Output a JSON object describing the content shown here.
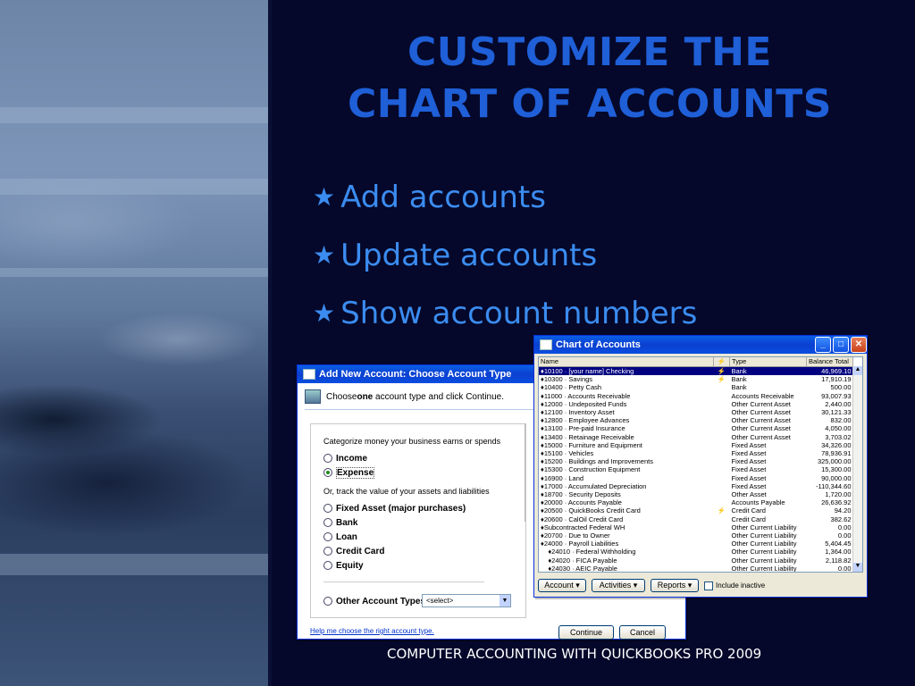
{
  "slide": {
    "title_line1": "CUSTOMIZE THE",
    "title_line2": "CHART OF ACCOUNTS",
    "bullets": [
      "Add accounts",
      "Update accounts",
      "Show account numbers"
    ],
    "bullet_icon": "star-icon",
    "footer": "COMPUTER ACCOUNTING WITH QUICKBOOKS PRO 2009",
    "colors": {
      "background": "#05082a",
      "title": "#1f5fd8",
      "bullet": "#3b8cf0",
      "footer": "#ffffff"
    }
  },
  "add_account_dialog": {
    "title": "Add New Account: Choose Account Type",
    "instruction_pre": "Choose ",
    "instruction_bold": "one",
    "instruction_post": " account type and click Continue.",
    "group1_label": "Categorize money your business earns or spends",
    "group1_options": [
      "Income",
      "Expense"
    ],
    "group2_label": "Or, track the value of your assets and liabilities",
    "group2_options": [
      "Fixed Asset (major purchases)",
      "Bank",
      "Loan",
      "Credit Card",
      "Equity"
    ],
    "other_label": "Other Account Types",
    "other_select": "<select>",
    "help_link": "Help me choose the right account type.",
    "continue_label": "Continue",
    "cancel_label": "Cancel"
  },
  "chart_of_accounts": {
    "title": "Chart of Accounts",
    "columns": [
      "Name",
      "",
      "Type",
      "Balance Total"
    ],
    "rows": [
      [
        "♦10100 · [your name] Checking",
        "⚡",
        "Bank",
        "46,969.10"
      ],
      [
        "♦10300 · Savings",
        "⚡",
        "Bank",
        "17,910.19"
      ],
      [
        "♦10400 · Petty Cash",
        "",
        "Bank",
        "500.00"
      ],
      [
        "♦11000 · Accounts Receivable",
        "",
        "Accounts Receivable",
        "93,007.93"
      ],
      [
        "♦12000 · Undeposited Funds",
        "",
        "Other Current Asset",
        "2,440.00"
      ],
      [
        "♦12100 · Inventory Asset",
        "",
        "Other Current Asset",
        "30,121.33"
      ],
      [
        "♦12800 · Employee Advances",
        "",
        "Other Current Asset",
        "832.00"
      ],
      [
        "♦13100 · Pre-paid Insurance",
        "",
        "Other Current Asset",
        "4,050.00"
      ],
      [
        "♦13400 · Retainage Receivable",
        "",
        "Other Current Asset",
        "3,703.02"
      ],
      [
        "♦15000 · Furniture and Equipment",
        "",
        "Fixed Asset",
        "34,326.00"
      ],
      [
        "♦15100 · Vehicles",
        "",
        "Fixed Asset",
        "78,936.91"
      ],
      [
        "♦15200 · Buildings and Improvements",
        "",
        "Fixed Asset",
        "325,000.00"
      ],
      [
        "♦15300 · Construction Equipment",
        "",
        "Fixed Asset",
        "15,300.00"
      ],
      [
        "♦16900 · Land",
        "",
        "Fixed Asset",
        "90,000.00"
      ],
      [
        "♦17000 · Accumulated Depreciation",
        "",
        "Fixed Asset",
        "-110,344.60"
      ],
      [
        "♦18700 · Security Deposits",
        "",
        "Other Asset",
        "1,720.00"
      ],
      [
        "♦20000 · Accounts Payable",
        "",
        "Accounts Payable",
        "26,636.92"
      ],
      [
        "♦20500 · QuickBooks Credit Card",
        "⚡",
        "Credit Card",
        "94.20"
      ],
      [
        "♦20600 · CalOil Credit Card",
        "",
        "Credit Card",
        "382.62"
      ],
      [
        "♦Subcontracted Federal WH",
        "",
        "Other Current Liability",
        "0.00"
      ],
      [
        "♦20700 · Due to Owner",
        "",
        "Other Current Liability",
        "0.00"
      ],
      [
        "♦24000 · Payroll Liabilities",
        "",
        "Other Current Liability",
        "5,404.45"
      ],
      [
        "    ♦24010 · Federal Withholding",
        "",
        "Other Current Liability",
        "1,364.00"
      ],
      [
        "    ♦24020 · FICA Payable",
        "",
        "Other Current Liability",
        "2,118.82"
      ],
      [
        "    ♦24030 · AEIC Payable",
        "",
        "Other Current Liability",
        "0.00"
      ]
    ],
    "buttons": [
      "Account",
      "Activities",
      "Reports"
    ],
    "include_inactive": "Include inactive"
  }
}
